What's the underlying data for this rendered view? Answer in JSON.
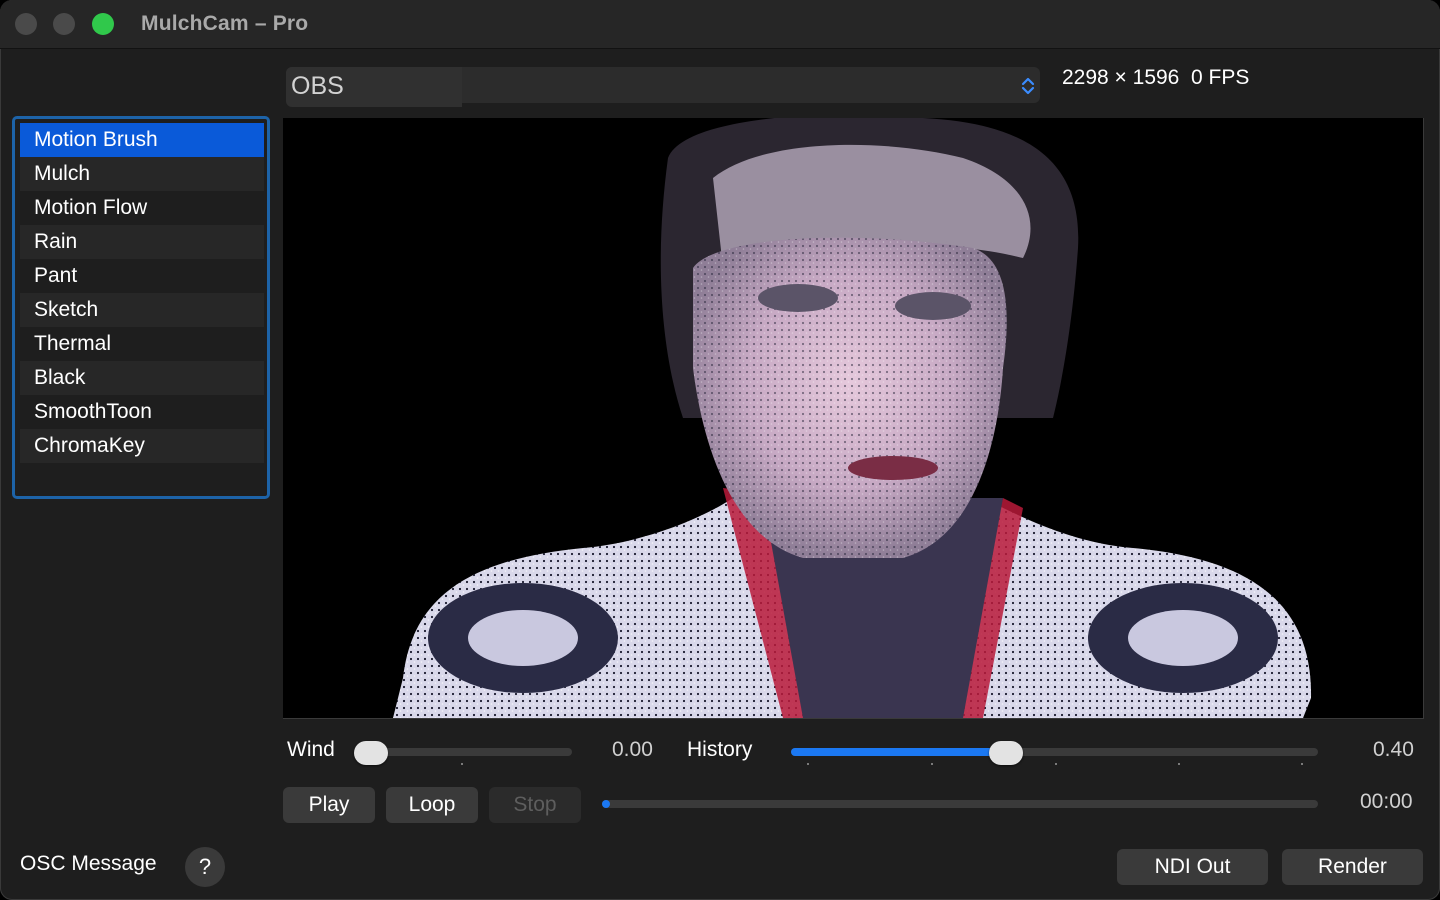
{
  "window": {
    "title": "MulchCam – Pro"
  },
  "source": {
    "selected": "OBS"
  },
  "status": {
    "resolution": "2298 × 1596",
    "fps": "0 FPS"
  },
  "effects": {
    "items": [
      {
        "label": "Motion Brush",
        "selected": true
      },
      {
        "label": "Mulch"
      },
      {
        "label": "Motion Flow"
      },
      {
        "label": "Rain"
      },
      {
        "label": "Pant"
      },
      {
        "label": "Sketch"
      },
      {
        "label": "Thermal"
      },
      {
        "label": "Black"
      },
      {
        "label": "SmoothToon"
      },
      {
        "label": "ChromaKey"
      }
    ]
  },
  "sliders": {
    "wind": {
      "label": "Wind",
      "value": "0.00",
      "fraction": 0.0
    },
    "history": {
      "label": "History",
      "value": "0.40",
      "fraction": 0.4
    }
  },
  "playback": {
    "play_label": "Play",
    "loop_label": "Loop",
    "stop_label": "Stop",
    "time": "00:00",
    "progress": 0.0
  },
  "footer": {
    "osc_label": "OSC Message",
    "help_label": "?",
    "ndi_label": "NDI Out",
    "render_label": "Render"
  },
  "colors": {
    "accent": "#0a5ad9",
    "slider_fill": "#1b78f2",
    "list_border": "#1d63a8",
    "zoom_green": "#30c84b"
  }
}
